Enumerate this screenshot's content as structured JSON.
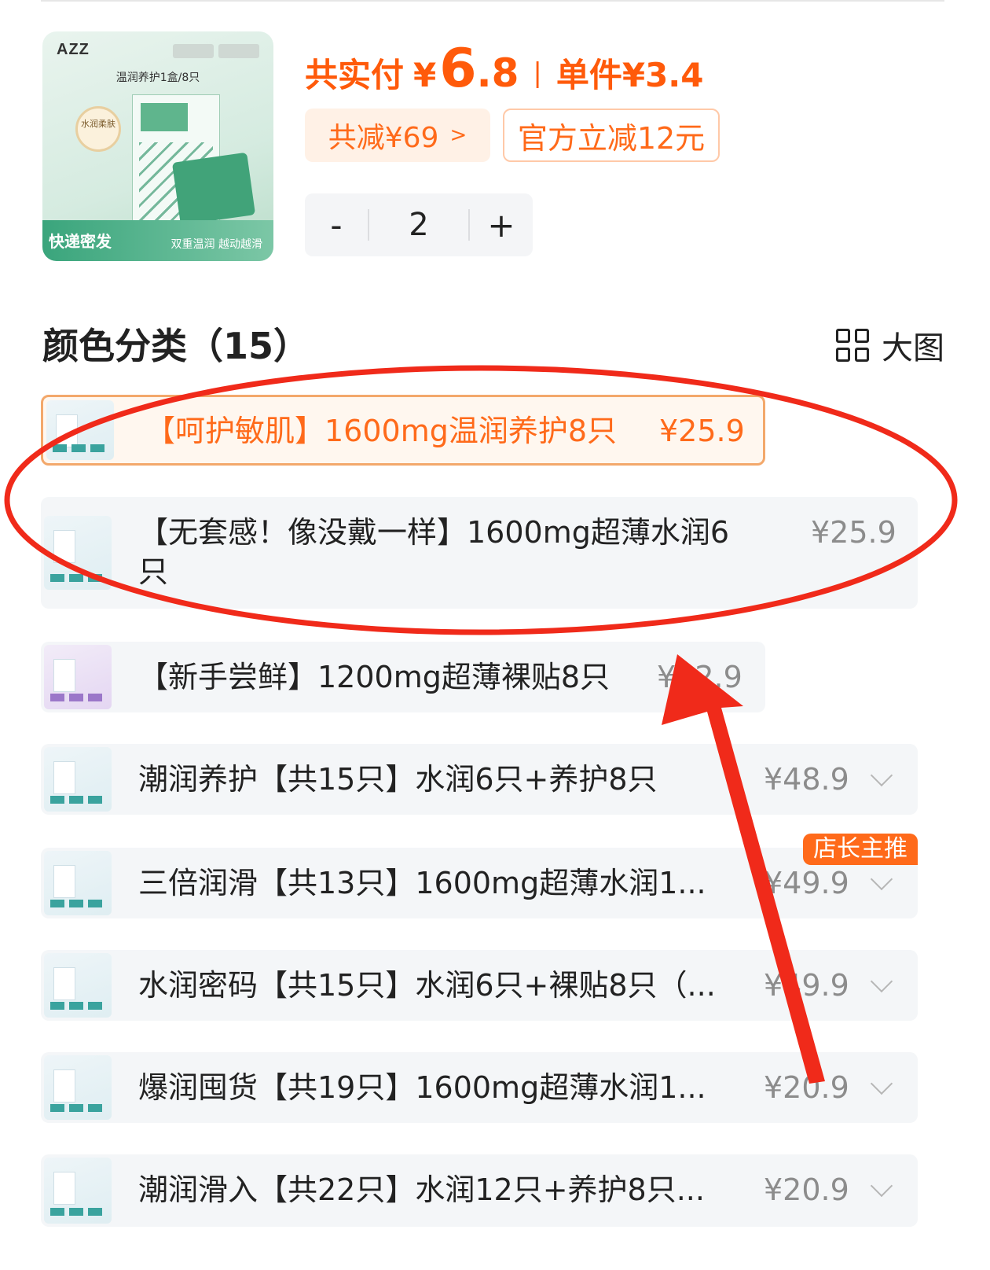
{
  "product": {
    "thumb_brand": "AZZ",
    "thumb_caption": "温润养护1盒/8只",
    "thumb_seal": "水润柔肤",
    "thumb_express": "快递密发",
    "thumb_slogan": "双重温润 越动越滑",
    "total_label": "共实付",
    "currency": "¥",
    "total_int": "6",
    "total_dec": ".8",
    "separator": "|",
    "unit_label": "单件¥3.4",
    "save_chip": "共减¥69",
    "save_arrow": ">",
    "official_chip": "官方立减12元"
  },
  "stepper": {
    "minus": "-",
    "value": "2",
    "plus": "+"
  },
  "section": {
    "title": "颜色分类（15）",
    "big_view": "大图"
  },
  "variants": [
    {
      "name": "【呵护敏肌】1600mg温润养护8只",
      "price": "¥25.9",
      "selected": true
    },
    {
      "name_line1": "【无套感！像没戴一样】1600mg超薄水润6",
      "name_line2": "只",
      "price": "¥25.9"
    },
    {
      "name": "【新手尝鲜】1200mg超薄裸贴8只",
      "price": "¥22.9"
    },
    {
      "name": "潮润养护【共15只】水润6只+养护8只",
      "price": "¥48.9"
    },
    {
      "name": "三倍润滑【共13只】1600mg超薄水润1...",
      "price": "¥49.9",
      "badge": "店长主推"
    },
    {
      "name": "水润密码【共15只】水润6只+裸贴8只（...",
      "price": "¥49.9"
    },
    {
      "name": "爆润囤货【共19只】1600mg超薄水润1...",
      "price": "¥20.9"
    },
    {
      "name": "潮润滑入【共22只】水润12只+养护8只...",
      "price": "¥20.9"
    }
  ],
  "colors": {
    "accent": "#ff5a0a",
    "annotation": "#f02a1a"
  }
}
